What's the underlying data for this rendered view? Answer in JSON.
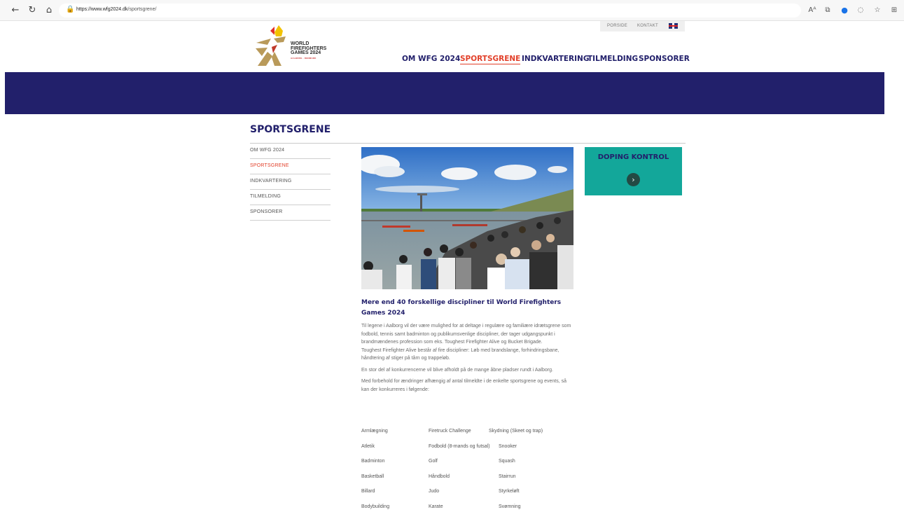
{
  "browser": {
    "url_host": "https://www.wfg2024.dk",
    "url_path": "/sportsgrene/",
    "icons": [
      "back-arrow-icon",
      "refresh-icon",
      "home-icon",
      "lock-icon",
      "read-aloud-icon",
      "tab-actions-icon",
      "extension-icon",
      "copilot-icon",
      "favorites-icon",
      "collections-icon"
    ]
  },
  "header": {
    "utility_links": [
      "PORSIDE",
      "KONTAKT"
    ],
    "logo_lines": [
      "WORLD",
      "FIREFIGHTERS",
      "GAMES 2024"
    ],
    "logo_sub": "AALBORG · DENMARK",
    "nav": [
      {
        "label": "OM WFG 2024",
        "active": false
      },
      {
        "label": "SPORTSGRENE",
        "active": true
      },
      {
        "label": "INDKVARTERING",
        "active": false
      },
      {
        "label": "TILMELDING",
        "active": false
      },
      {
        "label": "SPONSORER",
        "active": false
      }
    ]
  },
  "colors": {
    "brand_navy": "#22206b",
    "accent_red": "#e2402a",
    "teal": "#13a79a"
  },
  "page": {
    "title": "SPORTSGRENE",
    "side_nav": [
      {
        "label": "OM WFG 2024",
        "active": false
      },
      {
        "label": "SPORTSGRENE",
        "active": true
      },
      {
        "label": "INDKVARTERING",
        "active": false
      },
      {
        "label": "TILMELDING",
        "active": false
      },
      {
        "label": "SPONSORER",
        "active": false
      }
    ],
    "heading": "Mere end 40 forskellige discipliner til World Firefighters Games 2024",
    "para1": "Til legene i Aalborg vil der være mulighed for at deltage i regulære og familiære idrætsgrene som fodbold, tennis samt badminton og publikumsvenlige discipliner, der tager udgangspunkt i brandmændenes profession som eks. Toughest Firefighter Alive og Bucket Brigade.",
    "para1b": "Toughest Firefighter Alive består af fire discipliner: Løb med brandslange, forhindringsbane, håndtering af stiger på tårn og trappeløb.",
    "para2": "En stor del af konkurrencerne vil blive afholdt på de mange åbne pladser rundt i Aalborg.",
    "para3": "Med forbehold for ændringer afhængig af antal tilmeldte i de enkelte sportsgrene og events, så kan der konkurreres i følgende:",
    "sports_rows": [
      [
        "Armlægning",
        "Firetruck Challenge",
        "Skydning (Skeet og trap)"
      ],
      [
        "Atletik",
        "Fodbold (8-mands og futsal)",
        "Snooker"
      ],
      [
        "Badminton",
        "Golf",
        "Squash"
      ],
      [
        "Basketball",
        "Håndbold",
        "Stairrun"
      ],
      [
        "Billard",
        "Judo",
        "Styrkeløft"
      ],
      [
        "Bodybuilding",
        "Karate",
        "Svømning"
      ]
    ],
    "doping": {
      "title": "DOPING KONTROL",
      "button_icon": "chevron-right-icon"
    }
  }
}
